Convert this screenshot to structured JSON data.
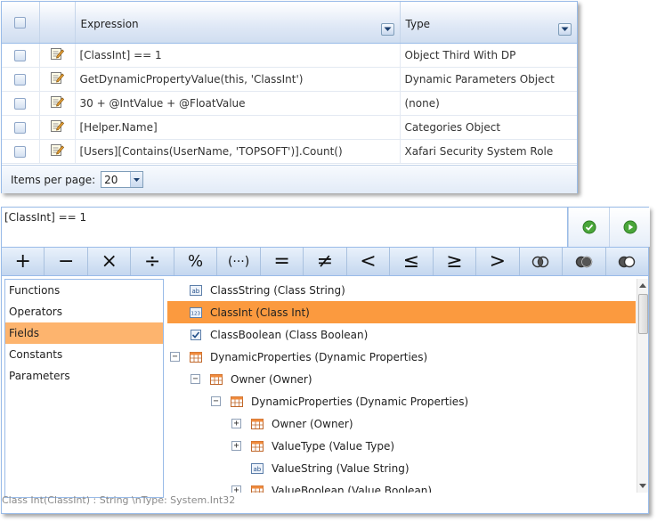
{
  "grid": {
    "columns": {
      "expression": "Expression",
      "type": "Type"
    },
    "rows": [
      {
        "expression": "[ClassInt] == 1",
        "type": "Object Third With DP"
      },
      {
        "expression": "GetDynamicPropertyValue(this, 'ClassInt')",
        "type": "Dynamic Parameters Object"
      },
      {
        "expression": "30 + @IntValue + @FloatValue",
        "type": "(none)"
      },
      {
        "expression": "[Helper.Name]",
        "type": "Categories Object"
      },
      {
        "expression": "[Users][Contains(UserName, 'TOPSOFT')].Count()",
        "type": "Xafari Security System Role"
      }
    ],
    "pager": {
      "label": "Items per page:",
      "value": "20"
    }
  },
  "editor": {
    "expression": "[ClassInt] == 1",
    "operators": [
      "+",
      "−",
      "×",
      "÷",
      "%",
      "(···)",
      "=",
      "≠",
      "<",
      "≤",
      "≥",
      ">"
    ],
    "categories": [
      "Functions",
      "Operators",
      "Fields",
      "Constants",
      "Parameters"
    ],
    "selected_category": "Fields",
    "tree": [
      {
        "label": "ClassString (Class String)",
        "icon": "string-field-icon"
      },
      {
        "label": "ClassInt (Class Int)",
        "icon": "int-field-icon"
      },
      {
        "label": "ClassBoolean (Class Boolean)",
        "icon": "boolean-field-icon"
      },
      {
        "label": "DynamicProperties (Dynamic Properties)",
        "icon": "table-icon"
      },
      {
        "label": "Owner (Owner)",
        "icon": "table-icon"
      },
      {
        "label": "DynamicProperties (Dynamic Properties)",
        "icon": "table-icon"
      },
      {
        "label": "Owner (Owner)",
        "icon": "table-icon"
      },
      {
        "label": "ValueType (Value Type)",
        "icon": "table-icon"
      },
      {
        "label": "ValueString (Value String)",
        "icon": "string-field-icon"
      },
      {
        "label": "ValueBoolean (Value Boolean)",
        "icon": "table-icon"
      }
    ],
    "status": "Class Int(ClassInt) : String \\nType: System.Int32"
  },
  "colors": {
    "accent": "#99bbe8",
    "selection": "#fb9a3f",
    "category_selection": "#fdb46e"
  }
}
